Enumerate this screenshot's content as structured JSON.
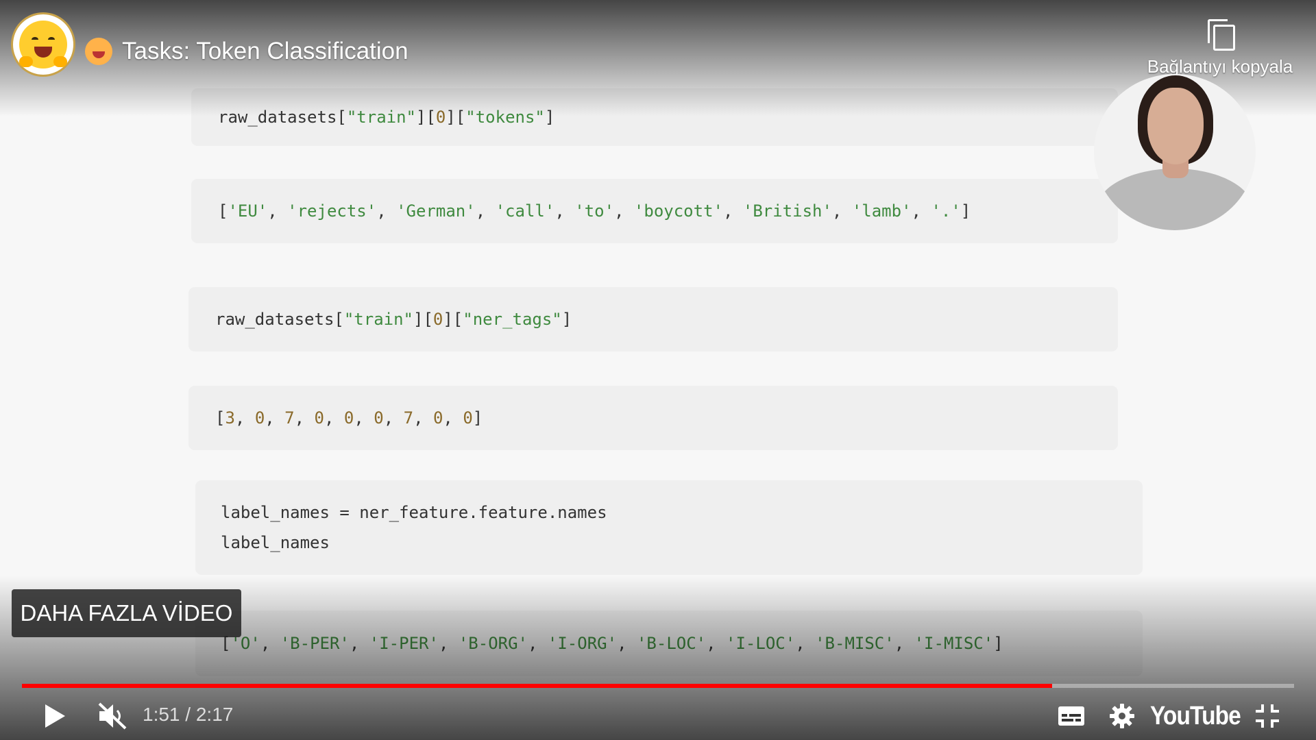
{
  "header": {
    "title": "Tasks: Token Classification",
    "copy_link_label": "Bağlantıyı kopyala"
  },
  "code_cells": [
    {
      "lines": [
        [
          {
            "t": "raw_datasets[",
            "c": "p"
          },
          {
            "t": "\"train\"",
            "c": "s"
          },
          {
            "t": "][",
            "c": "p"
          },
          {
            "t": "0",
            "c": "n"
          },
          {
            "t": "][",
            "c": "p"
          },
          {
            "t": "\"tokens\"",
            "c": "s"
          },
          {
            "t": "]",
            "c": "p"
          }
        ]
      ]
    },
    {
      "lines": [
        [
          {
            "t": "[",
            "c": "p"
          },
          {
            "t": "'EU'",
            "c": "s"
          },
          {
            "t": ", ",
            "c": "p"
          },
          {
            "t": "'rejects'",
            "c": "s"
          },
          {
            "t": ", ",
            "c": "p"
          },
          {
            "t": "'German'",
            "c": "s"
          },
          {
            "t": ", ",
            "c": "p"
          },
          {
            "t": "'call'",
            "c": "s"
          },
          {
            "t": ", ",
            "c": "p"
          },
          {
            "t": "'to'",
            "c": "s"
          },
          {
            "t": ", ",
            "c": "p"
          },
          {
            "t": "'boycott'",
            "c": "s"
          },
          {
            "t": ", ",
            "c": "p"
          },
          {
            "t": "'British'",
            "c": "s"
          },
          {
            "t": ", ",
            "c": "p"
          },
          {
            "t": "'lamb'",
            "c": "s"
          },
          {
            "t": ", ",
            "c": "p"
          },
          {
            "t": "'.'",
            "c": "s"
          },
          {
            "t": "]",
            "c": "p"
          }
        ]
      ]
    },
    {
      "lines": [
        [
          {
            "t": "raw_datasets[",
            "c": "p"
          },
          {
            "t": "\"train\"",
            "c": "s"
          },
          {
            "t": "][",
            "c": "p"
          },
          {
            "t": "0",
            "c": "n"
          },
          {
            "t": "][",
            "c": "p"
          },
          {
            "t": "\"ner_tags\"",
            "c": "s"
          },
          {
            "t": "]",
            "c": "p"
          }
        ]
      ]
    },
    {
      "lines": [
        [
          {
            "t": "[",
            "c": "p"
          },
          {
            "t": "3",
            "c": "n"
          },
          {
            "t": ", ",
            "c": "p"
          },
          {
            "t": "0",
            "c": "n"
          },
          {
            "t": ", ",
            "c": "p"
          },
          {
            "t": "7",
            "c": "n"
          },
          {
            "t": ", ",
            "c": "p"
          },
          {
            "t": "0",
            "c": "n"
          },
          {
            "t": ", ",
            "c": "p"
          },
          {
            "t": "0",
            "c": "n"
          },
          {
            "t": ", ",
            "c": "p"
          },
          {
            "t": "0",
            "c": "n"
          },
          {
            "t": ", ",
            "c": "p"
          },
          {
            "t": "7",
            "c": "n"
          },
          {
            "t": ", ",
            "c": "p"
          },
          {
            "t": "0",
            "c": "n"
          },
          {
            "t": ", ",
            "c": "p"
          },
          {
            "t": "0",
            "c": "n"
          },
          {
            "t": "]",
            "c": "p"
          }
        ]
      ]
    },
    {
      "lines": [
        [
          {
            "t": "label_names = ner_feature.feature.names",
            "c": "p"
          }
        ],
        [
          {
            "t": "label_names",
            "c": "p"
          }
        ]
      ]
    },
    {
      "lines": [
        [
          {
            "t": "[",
            "c": "p"
          },
          {
            "t": "'O'",
            "c": "s"
          },
          {
            "t": ", ",
            "c": "p"
          },
          {
            "t": "'B-PER'",
            "c": "s"
          },
          {
            "t": ", ",
            "c": "p"
          },
          {
            "t": "'I-PER'",
            "c": "s"
          },
          {
            "t": ", ",
            "c": "p"
          },
          {
            "t": "'B-ORG'",
            "c": "s"
          },
          {
            "t": ", ",
            "c": "p"
          },
          {
            "t": "'I-ORG'",
            "c": "s"
          },
          {
            "t": ", ",
            "c": "p"
          },
          {
            "t": "'B-LOC'",
            "c": "s"
          },
          {
            "t": ", ",
            "c": "p"
          },
          {
            "t": "'I-LOC'",
            "c": "s"
          },
          {
            "t": ", ",
            "c": "p"
          },
          {
            "t": "'B-MISC'",
            "c": "s"
          },
          {
            "t": ", ",
            "c": "p"
          },
          {
            "t": "'I-MISC'",
            "c": "s"
          },
          {
            "t": "]",
            "c": "p"
          }
        ]
      ]
    }
  ],
  "overlay": {
    "more_videos_label": "DAHA FAZLA VİDEO"
  },
  "player": {
    "current_time": "1:51",
    "duration": "2:17",
    "time_separator": " / ",
    "progress_fraction": 0.81,
    "logo_text": "YouTube",
    "accent_color": "#ff0000"
  },
  "icons": {
    "play": "play-icon",
    "mute": "volume-muted-icon",
    "subtitles": "subtitles-icon",
    "settings": "gear-icon",
    "exit_fullscreen": "exit-fullscreen-icon",
    "copy": "copy-icon"
  }
}
